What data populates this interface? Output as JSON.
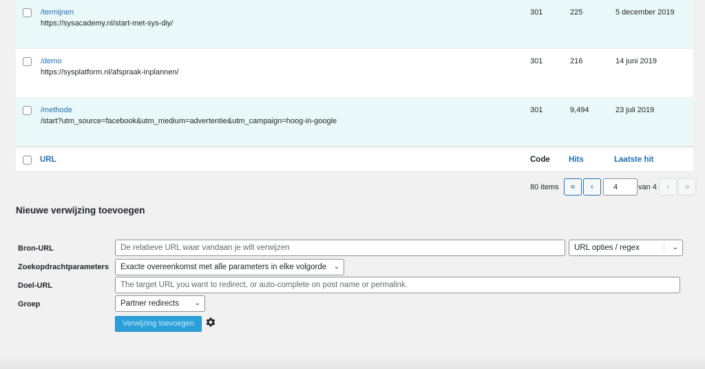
{
  "table": {
    "rows": [
      {
        "source": "/termijnen",
        "target": "https://sysacademy.nl/start-met-sys-diy/",
        "code": "301",
        "hits": "225",
        "last_hit": "5 december 2019"
      },
      {
        "source": "/demo",
        "target": "https://sysplatform.nl/afspraak-inplannen/",
        "code": "301",
        "hits": "216",
        "last_hit": "14 juni 2019"
      },
      {
        "source": "/methode",
        "target": "/start?utm_source=facebook&utm_medium=advertentie&utm_campaign=hoog-in-google",
        "code": "301",
        "hits": "9,494",
        "last_hit": "23 juli 2019"
      }
    ],
    "footer": {
      "url": "URL",
      "code": "Code",
      "hits": "Hits",
      "last_hit": "Laatste hit"
    }
  },
  "pagination": {
    "items": "80 items",
    "first": "«",
    "prev": "‹",
    "current": "4",
    "of": "van 4",
    "next": "›",
    "last": "»"
  },
  "form": {
    "title": "Nieuwe verwijzing toevoegen",
    "source_label": "Bron-URL",
    "source_placeholder": "De relatieve URL waar vandaan je wilt verwijzen",
    "url_options": "URL opties / regex",
    "query_label": "Zoekopdrachtparameters",
    "query_value": "Exacte overeenkomst met alle parameters in elke volgorde",
    "target_label": "Doel-URL",
    "target_placeholder": "The target URL you want to redirect, or auto-complete on post name or permalink.",
    "group_label": "Groep",
    "group_value": "Partner redirects",
    "submit": "Verwijzing toevoegen"
  },
  "icons": {
    "checkbox": "checkbox-icon",
    "chevron": "chevron-down-icon",
    "gear": "gear-icon"
  },
  "colors": {
    "link": "#2271b1",
    "row_alt": "#e9f8f8",
    "button": "#2a9fd9"
  }
}
